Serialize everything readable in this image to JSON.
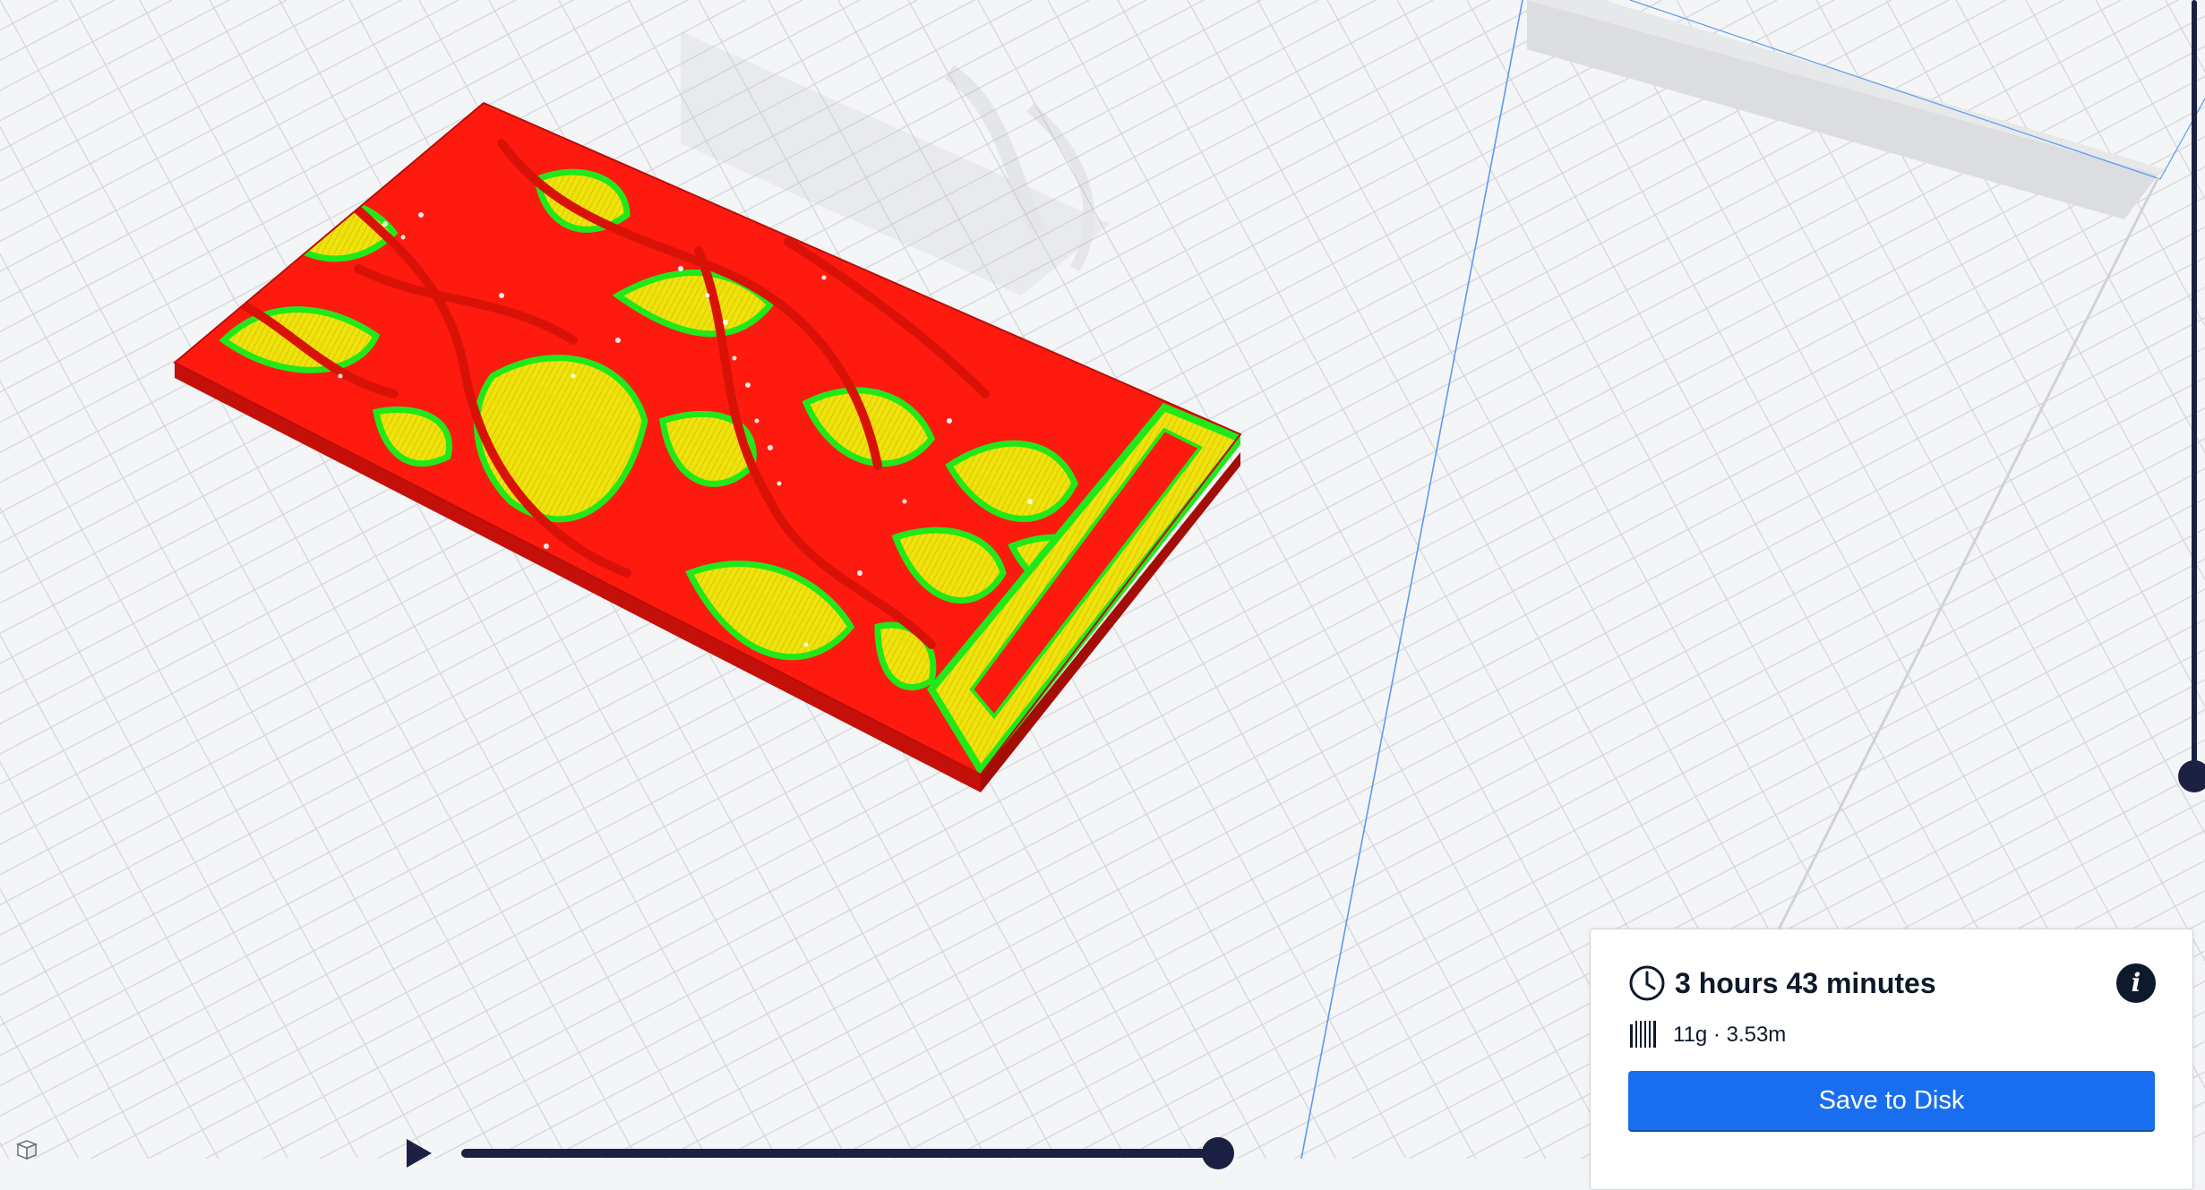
{
  "viewport": {
    "icons": {
      "view_cube": "view-cube-icon",
      "play": "play-icon"
    },
    "colors": {
      "background": "#f4f5f7",
      "grid_line": "#d5d7db",
      "build_volume_edge": "#4a90e2",
      "layer_wall_outer": "#ff1a0f",
      "layer_wall_inner": "#21e81a",
      "layer_infill": "#f0e20c",
      "slider": "#1c2143"
    }
  },
  "print_panel": {
    "print_time": "3 hours 43 minutes",
    "material_usage": "11g · 3.53m",
    "save_button_label": "Save to Disk",
    "icons": {
      "time": "clock-icon",
      "info": "info-icon",
      "material": "spool-icon"
    },
    "colors": {
      "accent": "#196ef0",
      "text": "#0e1a2b"
    }
  }
}
